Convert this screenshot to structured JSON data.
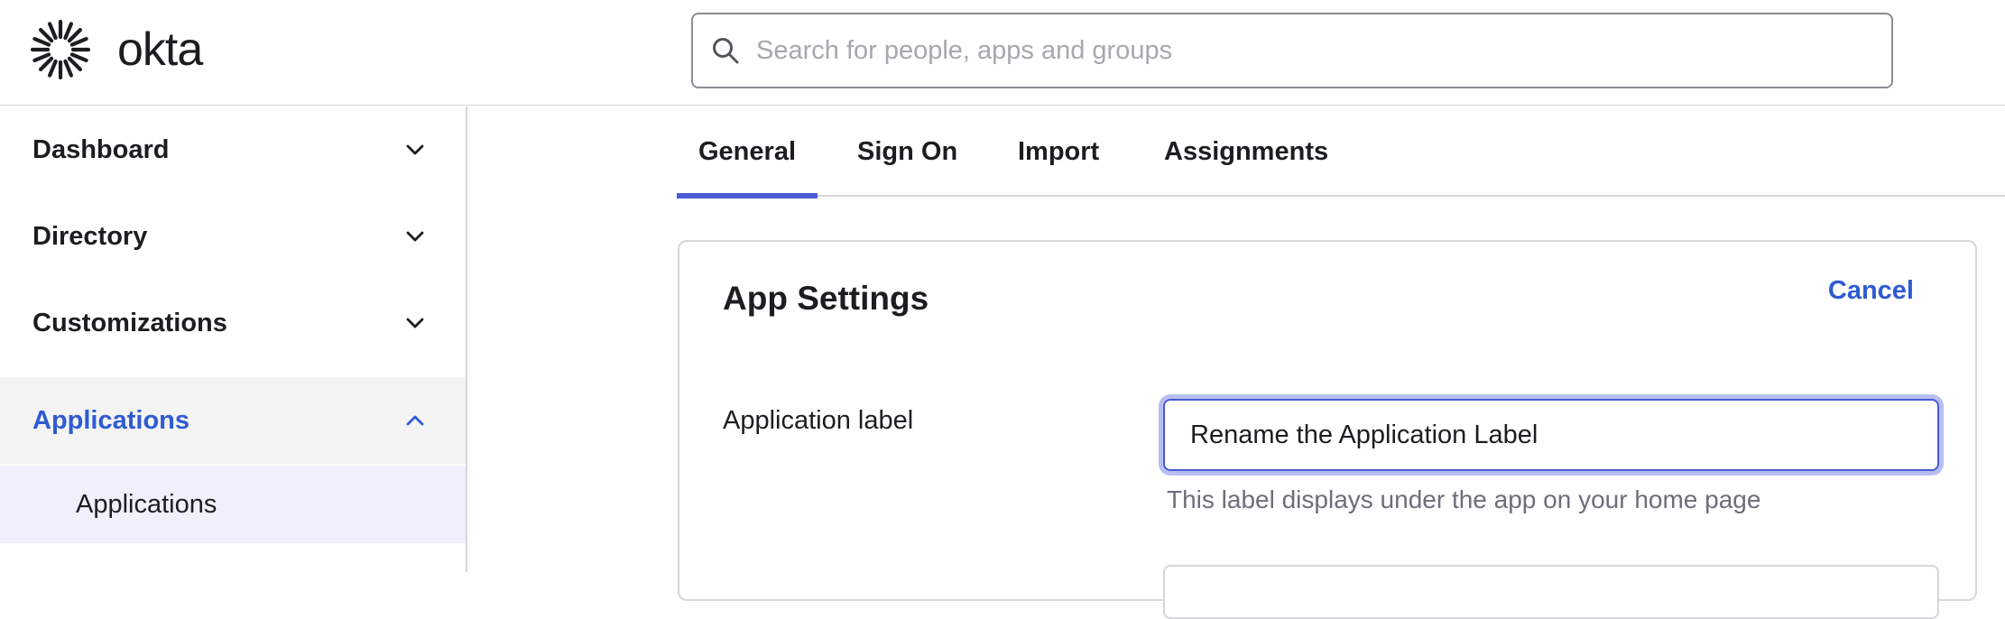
{
  "header": {
    "logo_text": "okta",
    "search": {
      "placeholder": "Search for people, apps and groups",
      "value": ""
    }
  },
  "sidebar": {
    "items": [
      {
        "label": "Dashboard",
        "expanded": false
      },
      {
        "label": "Directory",
        "expanded": false
      },
      {
        "label": "Customizations",
        "expanded": false
      },
      {
        "label": "Applications",
        "expanded": true
      }
    ],
    "subitems": [
      {
        "label": "Applications"
      }
    ]
  },
  "tabs": [
    {
      "label": "General",
      "active": true
    },
    {
      "label": "Sign On",
      "active": false
    },
    {
      "label": "Import",
      "active": false
    },
    {
      "label": "Assignments",
      "active": false
    }
  ],
  "panel": {
    "title": "App Settings",
    "cancel_label": "Cancel",
    "fields": [
      {
        "label": "Application label",
        "value": "Rename the Application Label",
        "help": "This label displays under the app on your home page"
      }
    ]
  },
  "colors": {
    "accent": "#2f5bd2",
    "tab_indicator": "#4a5bd6",
    "focus_ring": "#b7bff0",
    "active_nav_bg": "#f4f4f5",
    "active_subnav_bg": "#eef1fb"
  },
  "icons": [
    "okta-sunburst-logo-icon",
    "search-icon",
    "chevron-down-icon",
    "chevron-up-icon"
  ]
}
